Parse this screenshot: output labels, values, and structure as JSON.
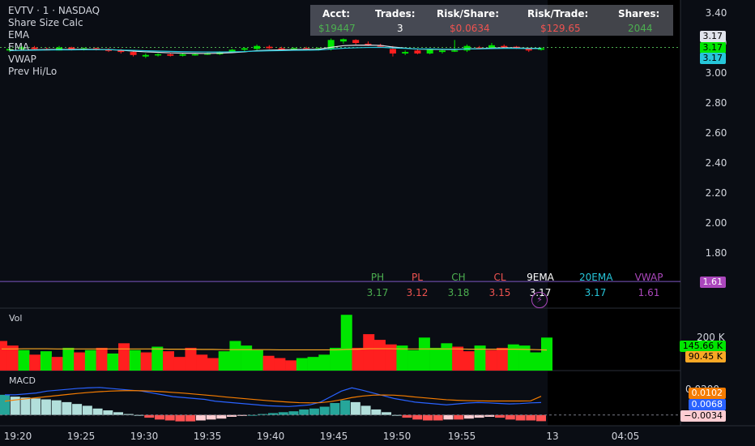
{
  "header": {
    "symbol_line": "EVTV · 1 · NASDAQ",
    "indicators": [
      "Share Size Calc",
      "EMA",
      "EMA",
      "VWAP",
      "Prev Hi/Lo"
    ]
  },
  "acct_panel": {
    "headers": [
      "Acct:",
      "Trades:",
      "Risk/Share:",
      "Risk/Trade:",
      "Shares:"
    ],
    "values": [
      "$19447",
      "3",
      "$0.0634",
      "$129.65",
      "2044"
    ],
    "value_colors": [
      "#4caf50",
      "#ffffff",
      "#ef5350",
      "#ef5350",
      "#4caf50"
    ]
  },
  "price_axis": {
    "ticks": [
      "3.40",
      "3.20",
      "3.00",
      "2.80",
      "2.60",
      "2.40",
      "2.20",
      "2.00",
      "1.80"
    ],
    "badges": [
      {
        "text": "3.17",
        "bg": "#e0e3eb",
        "fg": "#000000"
      },
      {
        "text": "3.17",
        "bg": "#00e600",
        "fg": "#000000"
      },
      {
        "text": "3.17",
        "bg": "#26c6da",
        "fg": "#000000"
      }
    ],
    "vwap_badge": {
      "text": "1.61",
      "bg": "#ab47bc",
      "fg": "#ffffff"
    }
  },
  "hilo_table": {
    "labels": [
      "PH",
      "PL",
      "CH",
      "CL",
      "9EMA",
      "20EMA",
      "VWAP"
    ],
    "values": [
      "3.17",
      "3.12",
      "3.18",
      "3.15",
      "3.17",
      "3.17",
      "1.61"
    ],
    "colors": [
      "#4caf50",
      "#ef5350",
      "#4caf50",
      "#ef5350",
      "#ffffff",
      "#26c6da",
      "#ab47bc"
    ]
  },
  "volume_panel": {
    "label": "Vol",
    "axis_label": "200 K",
    "badges": [
      {
        "text": "145.66 K",
        "bg": "#00e600",
        "fg": "#000000"
      },
      {
        "text": "90.45 K",
        "bg": "#f9a825",
        "fg": "#000000"
      }
    ]
  },
  "macd_panel": {
    "label": "MACD",
    "axis_label": "0.0200",
    "badges": [
      {
        "text": "0.0102",
        "bg": "#f57c00",
        "fg": "#ffffff"
      },
      {
        "text": "0.0068",
        "bg": "#2962ff",
        "fg": "#ffffff"
      },
      {
        "text": "−0.0034",
        "bg": "#ffcdd2",
        "fg": "#000000"
      }
    ]
  },
  "time_axis": {
    "ticks": [
      "19:20",
      "19:25",
      "19:30",
      "19:35",
      "19:40",
      "19:45",
      "19:50",
      "19:55",
      "13",
      "04:05"
    ]
  },
  "chart_data": [
    {
      "type": "candlestick",
      "title": "EVTV · 1 · NASDAQ",
      "ylim": [
        1.7,
        3.45
      ],
      "yticks": [
        3.4,
        3.2,
        3.0,
        2.8,
        2.6,
        2.4,
        2.2,
        2.0,
        1.8
      ],
      "candles": [
        {
          "o": 3.15,
          "h": 3.17,
          "l": 3.14,
          "c": 3.16
        },
        {
          "o": 3.16,
          "h": 3.18,
          "l": 3.15,
          "c": 3.17
        },
        {
          "o": 3.17,
          "h": 3.18,
          "l": 3.155,
          "c": 3.16
        },
        {
          "o": 3.16,
          "h": 3.17,
          "l": 3.15,
          "c": 3.15
        },
        {
          "o": 3.15,
          "h": 3.18,
          "l": 3.15,
          "c": 3.17
        },
        {
          "o": 3.17,
          "h": 3.175,
          "l": 3.15,
          "c": 3.155
        },
        {
          "o": 3.155,
          "h": 3.17,
          "l": 3.15,
          "c": 3.165
        },
        {
          "o": 3.165,
          "h": 3.17,
          "l": 3.15,
          "c": 3.155
        },
        {
          "o": 3.155,
          "h": 3.165,
          "l": 3.14,
          "c": 3.15
        },
        {
          "o": 3.15,
          "h": 3.16,
          "l": 3.13,
          "c": 3.14
        },
        {
          "o": 3.14,
          "h": 3.15,
          "l": 3.11,
          "c": 3.12
        },
        {
          "o": 3.11,
          "h": 3.13,
          "l": 3.1,
          "c": 3.12
        },
        {
          "o": 3.12,
          "h": 3.13,
          "l": 3.11,
          "c": 3.125
        },
        {
          "o": 3.125,
          "h": 3.13,
          "l": 3.11,
          "c": 3.115
        },
        {
          "o": 3.115,
          "h": 3.13,
          "l": 3.11,
          "c": 3.125
        },
        {
          "o": 3.12,
          "h": 3.13,
          "l": 3.115,
          "c": 3.125
        },
        {
          "o": 3.125,
          "h": 3.135,
          "l": 3.12,
          "c": 3.13
        },
        {
          "o": 3.125,
          "h": 3.145,
          "l": 3.12,
          "c": 3.14
        },
        {
          "o": 3.14,
          "h": 3.16,
          "l": 3.135,
          "c": 3.155
        },
        {
          "o": 3.155,
          "h": 3.17,
          "l": 3.145,
          "c": 3.165
        },
        {
          "o": 3.16,
          "h": 3.19,
          "l": 3.15,
          "c": 3.18
        },
        {
          "o": 3.175,
          "h": 3.185,
          "l": 3.16,
          "c": 3.165
        },
        {
          "o": 3.165,
          "h": 3.175,
          "l": 3.155,
          "c": 3.16
        },
        {
          "o": 3.16,
          "h": 3.17,
          "l": 3.155,
          "c": 3.165
        },
        {
          "o": 3.165,
          "h": 3.175,
          "l": 3.155,
          "c": 3.16
        },
        {
          "o": 3.16,
          "h": 3.17,
          "l": 3.15,
          "c": 3.165
        },
        {
          "o": 3.16,
          "h": 3.23,
          "l": 3.15,
          "c": 3.22
        },
        {
          "o": 3.21,
          "h": 3.23,
          "l": 3.195,
          "c": 3.225
        },
        {
          "o": 3.22,
          "h": 3.225,
          "l": 3.19,
          "c": 3.2
        },
        {
          "o": 3.195,
          "h": 3.21,
          "l": 3.18,
          "c": 3.19
        },
        {
          "o": 3.185,
          "h": 3.195,
          "l": 3.17,
          "c": 3.175
        },
        {
          "o": 3.16,
          "h": 3.18,
          "l": 3.11,
          "c": 3.13
        },
        {
          "o": 3.13,
          "h": 3.15,
          "l": 3.12,
          "c": 3.14
        },
        {
          "o": 3.15,
          "h": 3.16,
          "l": 3.125,
          "c": 3.13
        },
        {
          "o": 3.13,
          "h": 3.16,
          "l": 3.125,
          "c": 3.155
        },
        {
          "o": 3.14,
          "h": 3.16,
          "l": 3.13,
          "c": 3.15
        },
        {
          "o": 3.15,
          "h": 3.22,
          "l": 3.14,
          "c": 3.15
        },
        {
          "o": 3.15,
          "h": 3.19,
          "l": 3.14,
          "c": 3.18
        },
        {
          "o": 3.17,
          "h": 3.18,
          "l": 3.16,
          "c": 3.165
        },
        {
          "o": 3.165,
          "h": 3.2,
          "l": 3.16,
          "c": 3.185
        },
        {
          "o": 3.18,
          "h": 3.19,
          "l": 3.17,
          "c": 3.175
        },
        {
          "o": 3.175,
          "h": 3.18,
          "l": 3.16,
          "c": 3.165
        },
        {
          "o": 3.165,
          "h": 3.17,
          "l": 3.14,
          "c": 3.15
        },
        {
          "o": 3.155,
          "h": 3.17,
          "l": 3.15,
          "c": 3.165
        }
      ],
      "ema9": [
        3.15,
        3.152,
        3.155,
        3.156,
        3.157,
        3.157,
        3.158,
        3.157,
        3.156,
        3.152,
        3.146,
        3.141,
        3.138,
        3.134,
        3.132,
        3.131,
        3.13,
        3.132,
        3.136,
        3.141,
        3.149,
        3.152,
        3.154,
        3.156,
        3.157,
        3.158,
        3.171,
        3.182,
        3.185,
        3.186,
        3.184,
        3.173,
        3.166,
        3.159,
        3.158,
        3.157,
        3.156,
        3.161,
        3.162,
        3.166,
        3.168,
        3.167,
        3.164,
        3.164
      ],
      "ema20": [
        3.15,
        3.151,
        3.152,
        3.153,
        3.154,
        3.154,
        3.155,
        3.155,
        3.155,
        3.153,
        3.151,
        3.148,
        3.146,
        3.144,
        3.142,
        3.141,
        3.14,
        3.14,
        3.141,
        3.143,
        3.146,
        3.148,
        3.149,
        3.151,
        3.152,
        3.153,
        3.159,
        3.165,
        3.168,
        3.17,
        3.171,
        3.167,
        3.164,
        3.16,
        3.16,
        3.159,
        3.158,
        3.16,
        3.161,
        3.163,
        3.164,
        3.164,
        3.163,
        3.163
      ],
      "vwap": 1.61,
      "dotted_level": 3.17
    },
    {
      "type": "bar",
      "title": "Vol",
      "ylim": [
        0,
        260
      ],
      "unit": "K",
      "values": [
        130,
        110,
        90,
        70,
        85,
        60,
        100,
        80,
        90,
        100,
        75,
        120,
        90,
        80,
        105,
        85,
        60,
        100,
        70,
        55,
        85,
        130,
        110,
        90,
        65,
        55,
        45,
        55,
        60,
        70,
        100,
        245,
        100,
        160,
        135,
        115,
        110,
        90,
        145,
        100,
        120,
        105,
        85,
        110,
        90,
        100,
        115,
        110,
        80,
        145
      ],
      "directions": [
        "down",
        "down",
        "up",
        "down",
        "up",
        "down",
        "up",
        "down",
        "up",
        "down",
        "up",
        "down",
        "up",
        "down",
        "up",
        "down",
        "down",
        "down",
        "down",
        "down",
        "up",
        "up",
        "up",
        "up",
        "down",
        "down",
        "down",
        "up",
        "up",
        "up",
        "up",
        "up",
        "down",
        "down",
        "down",
        "down",
        "up",
        "up",
        "up",
        "up",
        "up",
        "down",
        "down",
        "up",
        "down",
        "down",
        "up",
        "up",
        "up",
        "up"
      ],
      "moving_avg": [
        95,
        95,
        96,
        96,
        96,
        95,
        95,
        95,
        95,
        95,
        95,
        95,
        95,
        95,
        95,
        94,
        94,
        94,
        93,
        93,
        92,
        92,
        92,
        92,
        92,
        91,
        91,
        91,
        91,
        91,
        91,
        93,
        94,
        96,
        96,
        96,
        95,
        95,
        95,
        95,
        95,
        95,
        94,
        94,
        94,
        94,
        94,
        93,
        92,
        90.45
      ]
    },
    {
      "type": "bar+line",
      "title": "MACD",
      "ylim": [
        -0.005,
        0.022
      ],
      "histogram": [
        0.011,
        0.01,
        0.0095,
        0.009,
        0.0085,
        0.008,
        0.007,
        0.006,
        0.005,
        0.0035,
        0.0025,
        0.0015,
        0.0005,
        0.0,
        -0.0015,
        -0.0025,
        -0.003,
        -0.0035,
        -0.0035,
        -0.003,
        -0.0025,
        -0.002,
        -0.001,
        -0.0005,
        0.0,
        0.0005,
        0.001,
        0.0015,
        0.002,
        0.003,
        0.0035,
        0.0045,
        0.0065,
        0.008,
        0.007,
        0.005,
        0.003,
        0.0015,
        0.0,
        -0.0015,
        -0.0025,
        -0.003,
        -0.003,
        -0.0025,
        -0.0025,
        -0.002,
        -0.0015,
        -0.001,
        -0.0015,
        -0.0025,
        -0.003,
        -0.003,
        -0.0034
      ],
      "macd_line": [
        0.011,
        0.011,
        0.0115,
        0.012,
        0.013,
        0.0135,
        0.014,
        0.0145,
        0.0148,
        0.015,
        0.0145,
        0.014,
        0.0135,
        0.013,
        0.012,
        0.011,
        0.01,
        0.0095,
        0.009,
        0.0085,
        0.0075,
        0.007,
        0.0065,
        0.006,
        0.0055,
        0.005,
        0.0048,
        0.0046,
        0.005,
        0.0055,
        0.007,
        0.01,
        0.013,
        0.0148,
        0.0135,
        0.012,
        0.0105,
        0.009,
        0.008,
        0.007,
        0.0065,
        0.006,
        0.0055,
        0.006,
        0.0065,
        0.0068,
        0.0066,
        0.0063,
        0.006,
        0.0062,
        0.0066,
        0.0068
      ],
      "signal_line": [
        0.0075,
        0.0082,
        0.0088,
        0.0094,
        0.01,
        0.0106,
        0.0112,
        0.0118,
        0.0123,
        0.0127,
        0.013,
        0.0132,
        0.0133,
        0.0132,
        0.013,
        0.0127,
        0.0123,
        0.0119,
        0.0114,
        0.0109,
        0.0104,
        0.0098,
        0.0093,
        0.0088,
        0.0083,
        0.0078,
        0.0074,
        0.007,
        0.0067,
        0.0066,
        0.0067,
        0.0073,
        0.0083,
        0.0095,
        0.0103,
        0.0108,
        0.0109,
        0.0108,
        0.0104,
        0.0098,
        0.0093,
        0.0088,
        0.0083,
        0.008,
        0.0078,
        0.0077,
        0.0076,
        0.0076,
        0.0076,
        0.0076,
        0.0077,
        0.0102
      ]
    }
  ]
}
